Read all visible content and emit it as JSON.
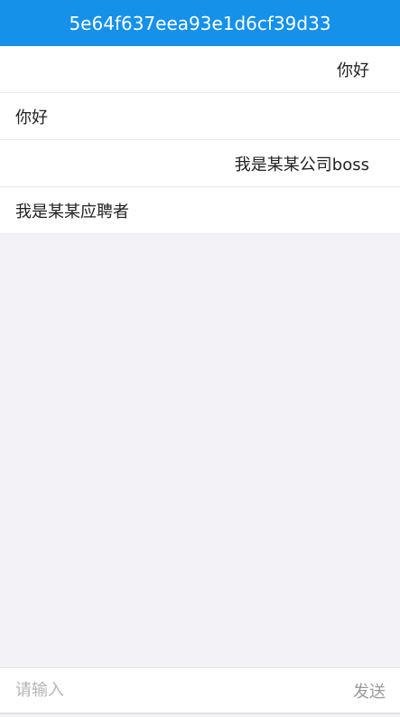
{
  "header": {
    "title": "5e64f637eea93e1d6cf39d33"
  },
  "messages": [
    {
      "side": "right",
      "text": "你好"
    },
    {
      "side": "left",
      "text": "你好"
    },
    {
      "side": "right",
      "text": "我是某某公司boss"
    },
    {
      "side": "left",
      "text": "我是某某应聘者"
    }
  ],
  "composer": {
    "placeholder": "请输入",
    "value": "",
    "send_label": "发送"
  }
}
